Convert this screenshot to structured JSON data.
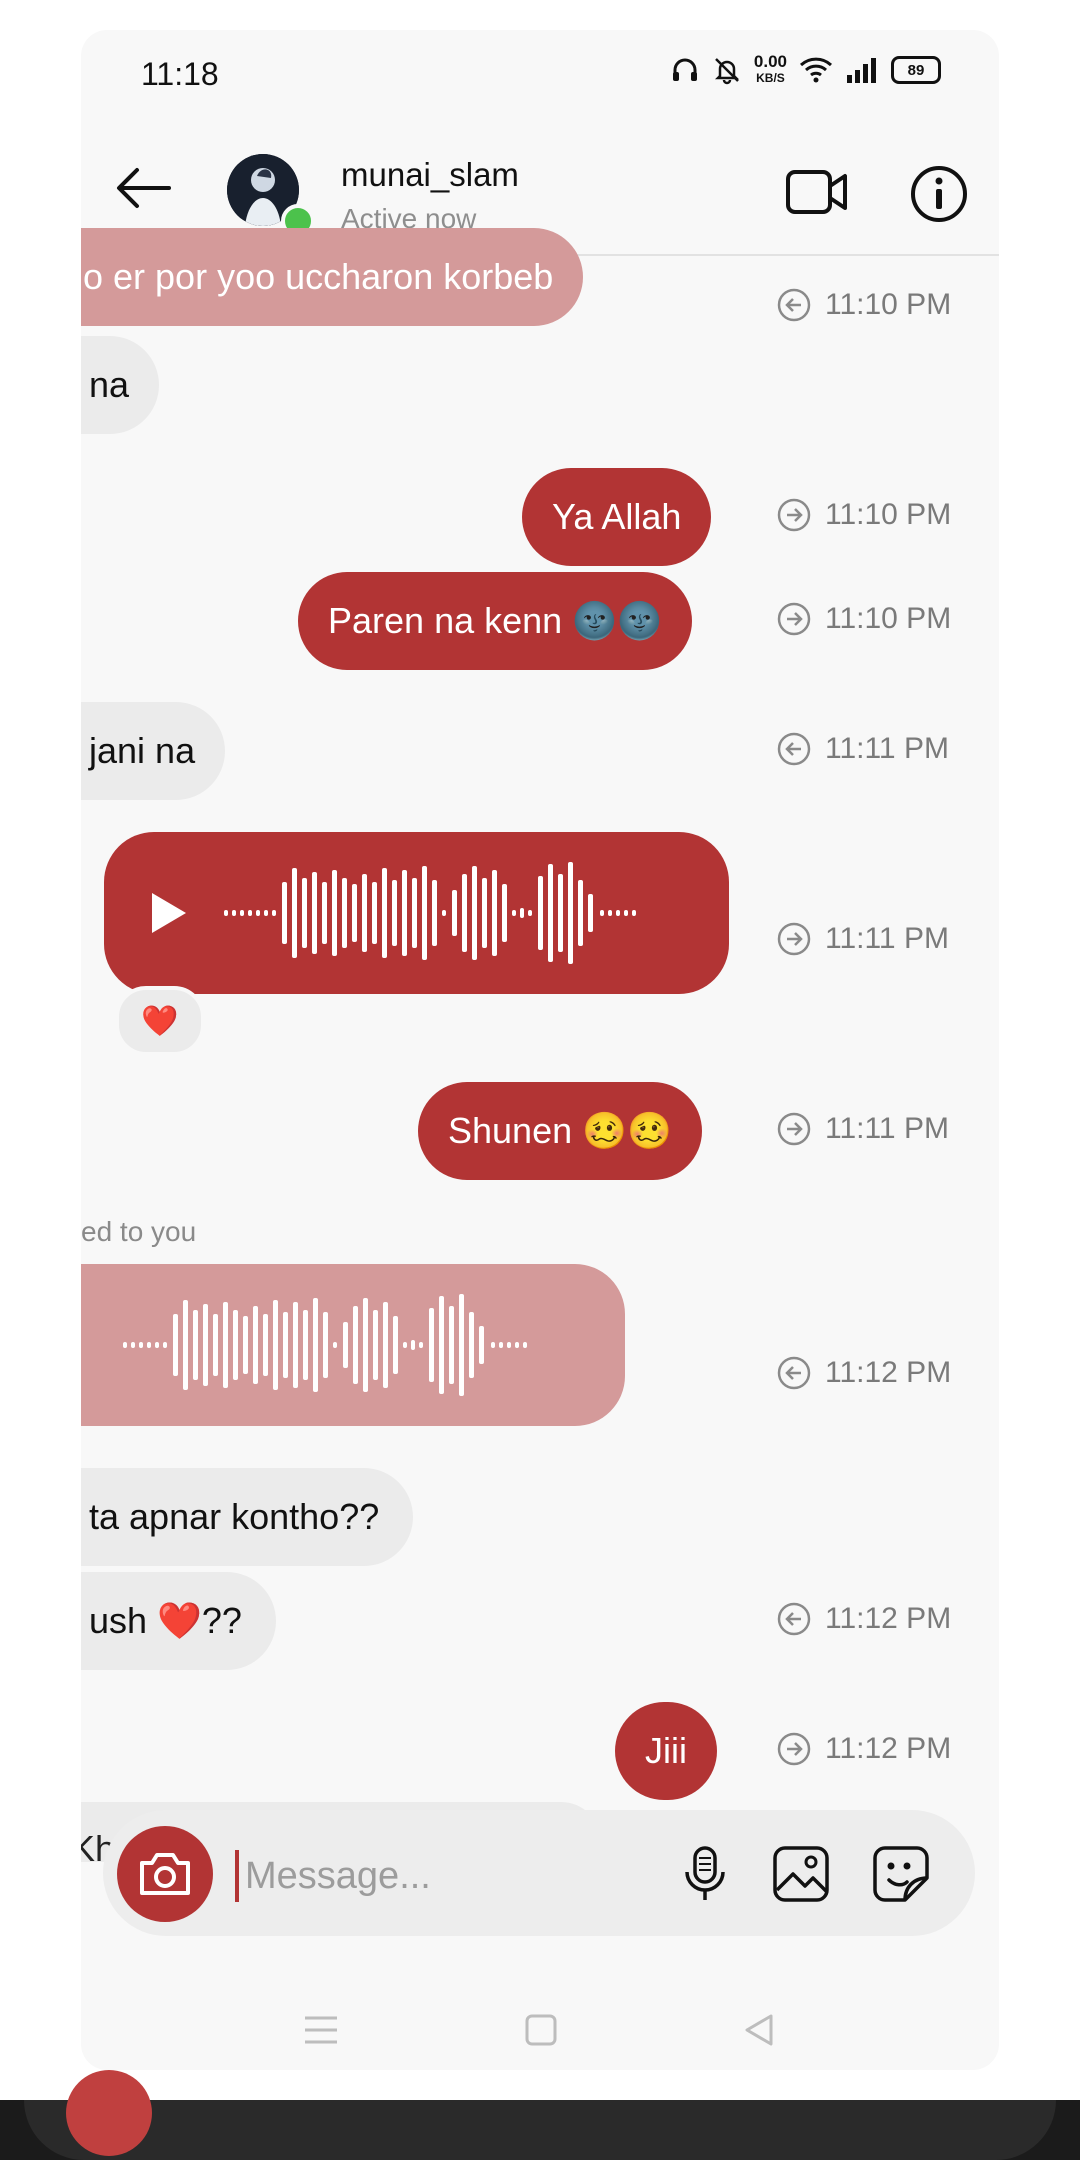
{
  "status_bar": {
    "time": "11:18",
    "speed_value": "0.00",
    "speed_unit": "KB/S",
    "battery": "89"
  },
  "header": {
    "username": "munai_slam",
    "status": "Active now"
  },
  "messages": [
    {
      "text": "o er por yoo uccharon korbeb",
      "time": "11:10 PM"
    },
    {
      "text": "na"
    },
    {
      "text": "Ya Allah",
      "time": "11:10 PM"
    },
    {
      "text": "Paren na kenn 🌚🌚",
      "time": "11:10 PM"
    },
    {
      "text": "jani na",
      "time": "11:11 PM"
    },
    {
      "text": "",
      "time": "11:11 PM"
    },
    {
      "text": "Shunen 🥴🥴",
      "time": "11:11 PM"
    },
    {
      "text": "",
      "time": "11:12 PM"
    },
    {
      "text": "ta apnar kontho??"
    },
    {
      "text": "ush ❤️??",
      "time": "11:12 PM"
    },
    {
      "text": "Jiii",
      "time": "11:12 PM"
    }
  ],
  "reaction": "❤️",
  "replied_label": "ed to you",
  "composer": {
    "placeholder": "Message...",
    "peek_text": "Kh"
  },
  "colors": {
    "outgoing": "#b23434",
    "incoming": "#ebebeb",
    "reply_pink": "#d49a9a"
  }
}
